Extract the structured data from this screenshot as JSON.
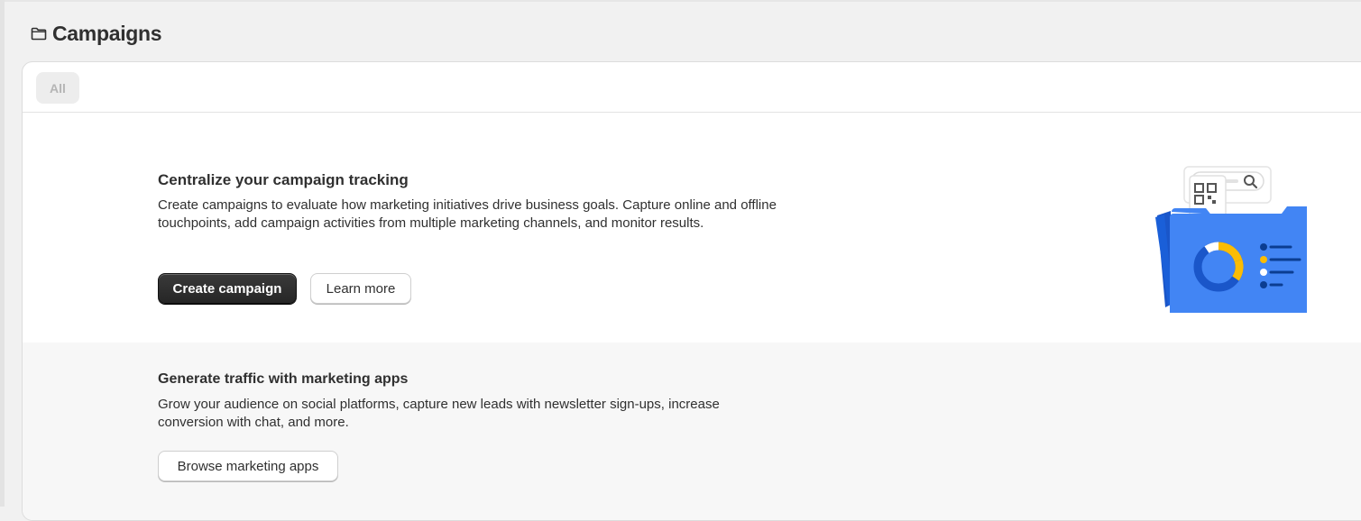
{
  "page": {
    "title": "Campaigns",
    "icon": "folder-icon"
  },
  "tabs": [
    {
      "label": "All",
      "selected": true
    }
  ],
  "empty_state": {
    "title": "Centralize your campaign tracking",
    "description": "Create campaigns to evaluate how marketing initiatives drive business goals. Capture online and offline touchpoints, add campaign activities from multiple marketing channels, and monitor results.",
    "primary_button": "Create campaign",
    "secondary_button": "Learn more",
    "illustration": "campaign-folder-illustration"
  },
  "apps_section": {
    "title": "Generate traffic with marketing apps",
    "description": "Grow your audience on social platforms, capture new leads with newsletter sign-ups, increase conversion with chat, and more.",
    "button": "Browse marketing apps"
  },
  "colors": {
    "accent_blue": "#4285f4",
    "dark_blue": "#1a56c9",
    "yellow": "#fbbc04",
    "primary_button": "#303030",
    "background": "#f1f1f1"
  }
}
